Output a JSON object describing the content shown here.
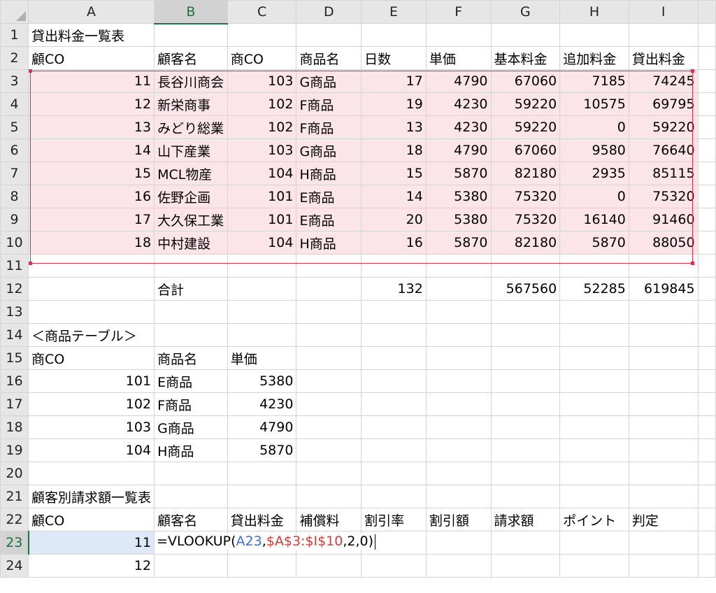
{
  "columns": [
    "A",
    "B",
    "C",
    "D",
    "E",
    "F",
    "G",
    "H",
    "I"
  ],
  "active_column": "B",
  "active_row": 23,
  "rows": [
    {
      "n": 1,
      "cells": [
        {
          "v": "貸出料金一覧表",
          "t": "txt"
        },
        {},
        {},
        {},
        {},
        {},
        {},
        {},
        {}
      ]
    },
    {
      "n": 2,
      "cells": [
        {
          "v": "顧CO",
          "t": "txt"
        },
        {
          "v": "顧客名",
          "t": "txt"
        },
        {
          "v": "商CO",
          "t": "txt"
        },
        {
          "v": "商品名",
          "t": "txt"
        },
        {
          "v": "日数",
          "t": "txt"
        },
        {
          "v": "単価",
          "t": "txt"
        },
        {
          "v": "基本料金",
          "t": "txt"
        },
        {
          "v": "追加料金",
          "t": "txt"
        },
        {
          "v": "貸出料金",
          "t": "txt"
        }
      ]
    },
    {
      "n": 3,
      "pink": true,
      "cells": [
        {
          "v": "11",
          "t": "num"
        },
        {
          "v": "長谷川商会",
          "t": "txt"
        },
        {
          "v": "103",
          "t": "num"
        },
        {
          "v": "G商品",
          "t": "txt"
        },
        {
          "v": "17",
          "t": "num"
        },
        {
          "v": "4790",
          "t": "num"
        },
        {
          "v": "67060",
          "t": "num"
        },
        {
          "v": "7185",
          "t": "num"
        },
        {
          "v": "74245",
          "t": "num"
        }
      ]
    },
    {
      "n": 4,
      "pink": true,
      "cells": [
        {
          "v": "12",
          "t": "num"
        },
        {
          "v": "新栄商事",
          "t": "txt"
        },
        {
          "v": "102",
          "t": "num"
        },
        {
          "v": "F商品",
          "t": "txt"
        },
        {
          "v": "19",
          "t": "num"
        },
        {
          "v": "4230",
          "t": "num"
        },
        {
          "v": "59220",
          "t": "num"
        },
        {
          "v": "10575",
          "t": "num"
        },
        {
          "v": "69795",
          "t": "num"
        }
      ]
    },
    {
      "n": 5,
      "pink": true,
      "cells": [
        {
          "v": "13",
          "t": "num"
        },
        {
          "v": "みどり総業",
          "t": "txt"
        },
        {
          "v": "102",
          "t": "num"
        },
        {
          "v": "F商品",
          "t": "txt"
        },
        {
          "v": "13",
          "t": "num"
        },
        {
          "v": "4230",
          "t": "num"
        },
        {
          "v": "59220",
          "t": "num"
        },
        {
          "v": "0",
          "t": "num"
        },
        {
          "v": "59220",
          "t": "num"
        }
      ]
    },
    {
      "n": 6,
      "pink": true,
      "cells": [
        {
          "v": "14",
          "t": "num"
        },
        {
          "v": "山下産業",
          "t": "txt"
        },
        {
          "v": "103",
          "t": "num"
        },
        {
          "v": "G商品",
          "t": "txt"
        },
        {
          "v": "18",
          "t": "num"
        },
        {
          "v": "4790",
          "t": "num"
        },
        {
          "v": "67060",
          "t": "num"
        },
        {
          "v": "9580",
          "t": "num"
        },
        {
          "v": "76640",
          "t": "num"
        }
      ]
    },
    {
      "n": 7,
      "pink": true,
      "cells": [
        {
          "v": "15",
          "t": "num"
        },
        {
          "v": "MCL物産",
          "t": "txt"
        },
        {
          "v": "104",
          "t": "num"
        },
        {
          "v": "H商品",
          "t": "txt"
        },
        {
          "v": "15",
          "t": "num"
        },
        {
          "v": "5870",
          "t": "num"
        },
        {
          "v": "82180",
          "t": "num"
        },
        {
          "v": "2935",
          "t": "num"
        },
        {
          "v": "85115",
          "t": "num"
        }
      ]
    },
    {
      "n": 8,
      "pink": true,
      "cells": [
        {
          "v": "16",
          "t": "num"
        },
        {
          "v": "佐野企画",
          "t": "txt"
        },
        {
          "v": "101",
          "t": "num"
        },
        {
          "v": "E商品",
          "t": "txt"
        },
        {
          "v": "14",
          "t": "num"
        },
        {
          "v": "5380",
          "t": "num"
        },
        {
          "v": "75320",
          "t": "num"
        },
        {
          "v": "0",
          "t": "num"
        },
        {
          "v": "75320",
          "t": "num"
        }
      ]
    },
    {
      "n": 9,
      "pink": true,
      "cells": [
        {
          "v": "17",
          "t": "num"
        },
        {
          "v": "大久保工業",
          "t": "txt"
        },
        {
          "v": "101",
          "t": "num"
        },
        {
          "v": "E商品",
          "t": "txt"
        },
        {
          "v": "20",
          "t": "num"
        },
        {
          "v": "5380",
          "t": "num"
        },
        {
          "v": "75320",
          "t": "num"
        },
        {
          "v": "16140",
          "t": "num"
        },
        {
          "v": "91460",
          "t": "num"
        }
      ]
    },
    {
      "n": 10,
      "pink": true,
      "cells": [
        {
          "v": "18",
          "t": "num"
        },
        {
          "v": "中村建設",
          "t": "txt"
        },
        {
          "v": "104",
          "t": "num"
        },
        {
          "v": "H商品",
          "t": "txt"
        },
        {
          "v": "16",
          "t": "num"
        },
        {
          "v": "5870",
          "t": "num"
        },
        {
          "v": "82180",
          "t": "num"
        },
        {
          "v": "5870",
          "t": "num"
        },
        {
          "v": "88050",
          "t": "num"
        }
      ]
    },
    {
      "n": 11,
      "cells": [
        {},
        {},
        {},
        {},
        {},
        {},
        {},
        {},
        {}
      ]
    },
    {
      "n": 12,
      "cells": [
        {},
        {
          "v": "合計",
          "t": "txt"
        },
        {},
        {},
        {
          "v": "132",
          "t": "num"
        },
        {},
        {
          "v": "567560",
          "t": "num"
        },
        {
          "v": "52285",
          "t": "num"
        },
        {
          "v": "619845",
          "t": "num"
        }
      ]
    },
    {
      "n": 13,
      "cells": [
        {},
        {},
        {},
        {},
        {},
        {},
        {},
        {},
        {}
      ]
    },
    {
      "n": 14,
      "cells": [
        {
          "v": "＜商品テーブル＞",
          "t": "txt"
        },
        {},
        {},
        {},
        {},
        {},
        {},
        {},
        {}
      ]
    },
    {
      "n": 15,
      "cells": [
        {
          "v": "商CO",
          "t": "txt"
        },
        {
          "v": "商品名",
          "t": "txt"
        },
        {
          "v": "単価",
          "t": "txt"
        },
        {},
        {},
        {},
        {},
        {},
        {}
      ]
    },
    {
      "n": 16,
      "cells": [
        {
          "v": "101",
          "t": "num"
        },
        {
          "v": "E商品",
          "t": "txt"
        },
        {
          "v": "5380",
          "t": "num"
        },
        {},
        {},
        {},
        {},
        {},
        {}
      ]
    },
    {
      "n": 17,
      "cells": [
        {
          "v": "102",
          "t": "num"
        },
        {
          "v": "F商品",
          "t": "txt"
        },
        {
          "v": "4230",
          "t": "num"
        },
        {},
        {},
        {},
        {},
        {},
        {}
      ]
    },
    {
      "n": 18,
      "cells": [
        {
          "v": "103",
          "t": "num"
        },
        {
          "v": "G商品",
          "t": "txt"
        },
        {
          "v": "4790",
          "t": "num"
        },
        {},
        {},
        {},
        {},
        {},
        {}
      ]
    },
    {
      "n": 19,
      "cells": [
        {
          "v": "104",
          "t": "num"
        },
        {
          "v": "H商品",
          "t": "txt"
        },
        {
          "v": "5870",
          "t": "num"
        },
        {},
        {},
        {},
        {},
        {},
        {}
      ]
    },
    {
      "n": 20,
      "cells": [
        {},
        {},
        {},
        {},
        {},
        {},
        {},
        {},
        {}
      ]
    },
    {
      "n": 21,
      "cells": [
        {
          "v": "顧客別請求額一覧表",
          "t": "txt"
        },
        {},
        {},
        {},
        {},
        {},
        {},
        {},
        {}
      ]
    },
    {
      "n": 22,
      "cells": [
        {
          "v": "顧CO",
          "t": "txt"
        },
        {
          "v": "顧客名",
          "t": "txt"
        },
        {
          "v": "貸出料金",
          "t": "txt"
        },
        {
          "v": "補償料",
          "t": "txt"
        },
        {
          "v": "割引率",
          "t": "txt"
        },
        {
          "v": "割引額",
          "t": "txt"
        },
        {
          "v": "請求額",
          "t": "txt"
        },
        {
          "v": "ポイント",
          "t": "txt"
        },
        {
          "v": "判定",
          "t": "txt"
        }
      ]
    },
    {
      "n": 23,
      "cells": [
        {
          "v": "11",
          "t": "num",
          "active": true
        },
        {
          "formula": true
        },
        {},
        {},
        {},
        {},
        {},
        {},
        {}
      ]
    },
    {
      "n": 24,
      "cells": [
        {
          "v": "12",
          "t": "num"
        },
        {},
        {},
        {},
        {},
        {},
        {},
        {},
        {}
      ]
    }
  ],
  "formula": {
    "prefix": "=VLOOKUP(",
    "ref1": "A23",
    "sep1": ",",
    "ref2": "$A$3:$I$10",
    "suffix": ",2,0)"
  },
  "highlight_color": "#d8334a",
  "accent_color": "#217346"
}
